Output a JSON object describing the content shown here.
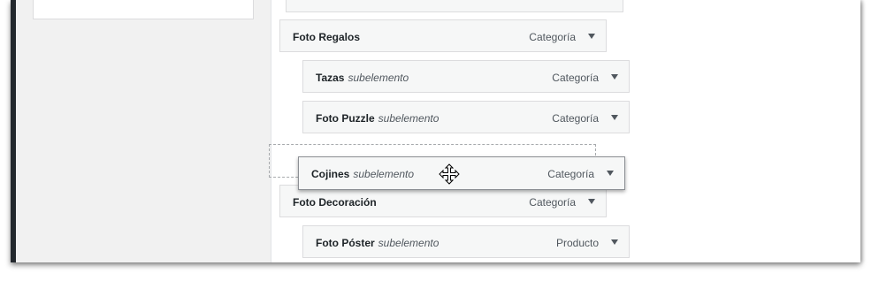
{
  "menu": {
    "items": [
      {
        "title": "Foto Regalos",
        "subtitle": "",
        "type": "Categoría"
      },
      {
        "title": "Tazas",
        "subtitle": "subelemento",
        "type": "Categoría"
      },
      {
        "title": "Foto Puzzle",
        "subtitle": "subelemento",
        "type": "Categoría"
      },
      {
        "title": "Foto Decoración",
        "subtitle": "",
        "type": "Categoría"
      },
      {
        "title": "Foto Póster",
        "subtitle": "subelemento",
        "type": "Producto"
      }
    ],
    "dragging_item": {
      "title": "Cojines",
      "subtitle": "subelemento",
      "type": "Categoría"
    }
  },
  "icons": {
    "toggle": "chevron-down-icon",
    "cursor": "move-cursor-icon"
  },
  "colors": {
    "item_bg": "#f6f7f7",
    "border": "#dcdcde",
    "sidebar_edge": "#23282d"
  }
}
